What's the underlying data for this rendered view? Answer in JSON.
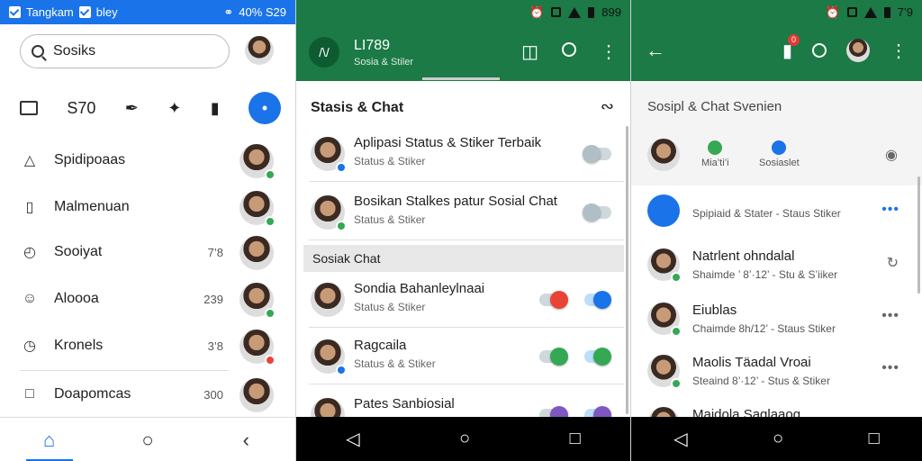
{
  "screen1": {
    "status": {
      "left": "Tangkam",
      "mid": "bley",
      "right": "40% S29"
    },
    "search": {
      "placeholder": "Sosiks"
    },
    "toolbar": {
      "label": "S70"
    },
    "menu": [
      {
        "label": "Spidipoaas",
        "icon": "alert-triangle-icon",
        "count": "",
        "badge": "#34a853"
      },
      {
        "label": "Malmenuan",
        "icon": "bookmark-icon",
        "count": "",
        "badge": "#34a853"
      },
      {
        "label": "Sooiyat",
        "icon": "clock-icon",
        "count": "7’8",
        "badge": ""
      },
      {
        "label": "Aloooa",
        "icon": "smile-icon",
        "count": "239",
        "badge": "#34a853"
      },
      {
        "label": "Kronels",
        "icon": "clock-alert-icon",
        "count": "3’8",
        "badge": "#ea4335"
      },
      {
        "label": "Doapomcas",
        "icon": "square-icon",
        "count": "300",
        "badge": ""
      }
    ],
    "colors": {
      "accent": "#1a73e8"
    }
  },
  "screen2": {
    "status_time": "899",
    "app": {
      "title": "LI789",
      "subtitle": "Sosia & Stiler",
      "logo_glyph": "/\\/"
    },
    "section1_title": "Stasis & Chat",
    "section2_title": "Sosiak Chat",
    "rows": [
      {
        "title": "Aplipasi Status & Stiker Terbaik",
        "sub": "Status & Stiker",
        "toggle_color": "#b0bec5",
        "toggle_on": false,
        "badge": "#1a73e8"
      },
      {
        "title": "Bosikan Stalkes patur Sosial Chat",
        "sub": "Status & Stiker",
        "toggle_color": "#b0bec5",
        "toggle_on": false,
        "badge": "#34a853"
      },
      {
        "title": "Sondia Bahanleylnaai",
        "sub": "Status & Stiker",
        "toggle_color": "#ea4335",
        "toggle_on": true,
        "badge": ""
      },
      {
        "title": "Ragcaila",
        "sub": "Status & & Stiker",
        "toggle_color": "#34a853",
        "toggle_on": true,
        "badge": "#1a73e8"
      },
      {
        "title": "Pates Sanbiosial",
        "sub": "",
        "toggle_color": "#7e57c2",
        "toggle_on": true,
        "badge": ""
      }
    ],
    "colors": {
      "primary": "#1b7a45"
    }
  },
  "screen3": {
    "status_time": "7’9",
    "title": "Sosipl & Chat Svenien",
    "tabs": [
      {
        "label": "Mia’ti’i",
        "color": "#34a853"
      },
      {
        "label": "Sosiaslet",
        "color": "#1a73e8"
      }
    ],
    "notification_badge": "0",
    "rows": [
      {
        "title": "",
        "sub": "Spipiaid & Stater - Staus Stiker",
        "badge": "",
        "more": "•••",
        "more_color": "#1a73e8"
      },
      {
        "title": "Natrlent ohndalal",
        "sub": "Shaimde ’ 8’·12’ - Stu & S’iiker",
        "badge": "#34a853",
        "more": "↻",
        "more_color": "#666"
      },
      {
        "title": "Eiublas",
        "sub": "Chaimde 8h/12’ - Staus Stiker",
        "badge": "#34a853",
        "more": "•••",
        "more_color": "#666"
      },
      {
        "title": "Maolis Täadal Vroai",
        "sub": "Steaind 8’·12’ - Stus & Stiker",
        "badge": "#34a853",
        "more": "•••",
        "more_color": "#666"
      },
      {
        "title": "Maidola Saglaaog",
        "sub": "",
        "badge": "#34a853",
        "more": "",
        "more_color": "#666"
      }
    ]
  }
}
